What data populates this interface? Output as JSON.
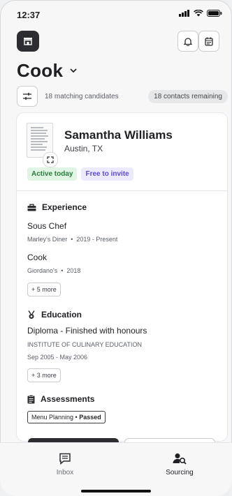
{
  "status_bar": {
    "time": "12:37"
  },
  "header": {
    "title": "Cook",
    "matching_text": "18 matching candidates",
    "contacts_remaining": "18 contacts remaining"
  },
  "candidate": {
    "name": "Samantha Williams",
    "location": "Austin, TX",
    "badges": [
      "Active today",
      "Free to invite"
    ],
    "experience": {
      "heading": "Experience",
      "jobs": [
        {
          "title": "Sous Chef",
          "employer": "Marley's Diner",
          "period": "2019 - Present"
        },
        {
          "title": "Cook",
          "employer": "Giordano's",
          "period": "2018"
        }
      ],
      "more": "+ 5 more"
    },
    "education": {
      "heading": "Education",
      "degree": "Diploma - Finished with honours",
      "school": "INSTITUTE OF CULINARY EDUCATION",
      "period": "Sep 2005 - May 2006",
      "more": "+ 3 more"
    },
    "assessments": {
      "heading": "Assessments",
      "item_name": "Menu Planning",
      "item_result": "Passed"
    }
  },
  "tabbar": {
    "items": [
      {
        "label": "Inbox",
        "icon": "message-icon",
        "active": false
      },
      {
        "label": "Sourcing",
        "icon": "person-search-icon",
        "active": true
      }
    ]
  },
  "colors": {
    "accent_dark": "#2b2d31",
    "active_green_bg": "#e0f5e4",
    "free_purple_bg": "#eceafd"
  }
}
